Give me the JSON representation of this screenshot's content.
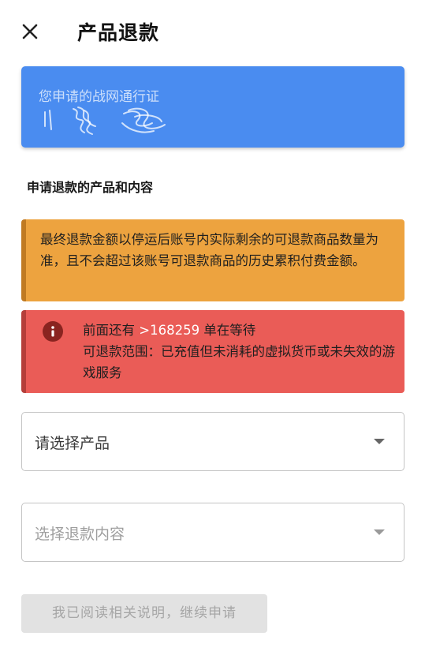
{
  "header": {
    "close_icon": "close-icon",
    "title": "产品退款"
  },
  "account_card": {
    "label": "您申请的战网通行证",
    "background_color": "#4a8cf0"
  },
  "section": {
    "title": "申请退款的产品和内容"
  },
  "warning_notice": {
    "text": "最终退款金额以停运后账号内实际剩余的可退款商品数量为准，且不会超过该账号可退款商品的历史累积付费金额。",
    "background_color": "#eda33f"
  },
  "error_notice": {
    "icon": "info-icon",
    "queue_prefix": "前面还有 ",
    "queue_count": ">168259",
    "queue_suffix": " 单在等待",
    "scope_text": "可退款范围：已充值但未消耗的虚拟货币或未失效的游戏服务",
    "background_color": "#ea5c57"
  },
  "product_select": {
    "placeholder": "请选择产品",
    "icon": "dropdown-arrow-icon"
  },
  "content_select": {
    "placeholder": "选择退款内容",
    "icon": "dropdown-arrow-icon"
  },
  "submit_button": {
    "label": "我已阅读相关说明，继续申请",
    "state": "disabled"
  }
}
